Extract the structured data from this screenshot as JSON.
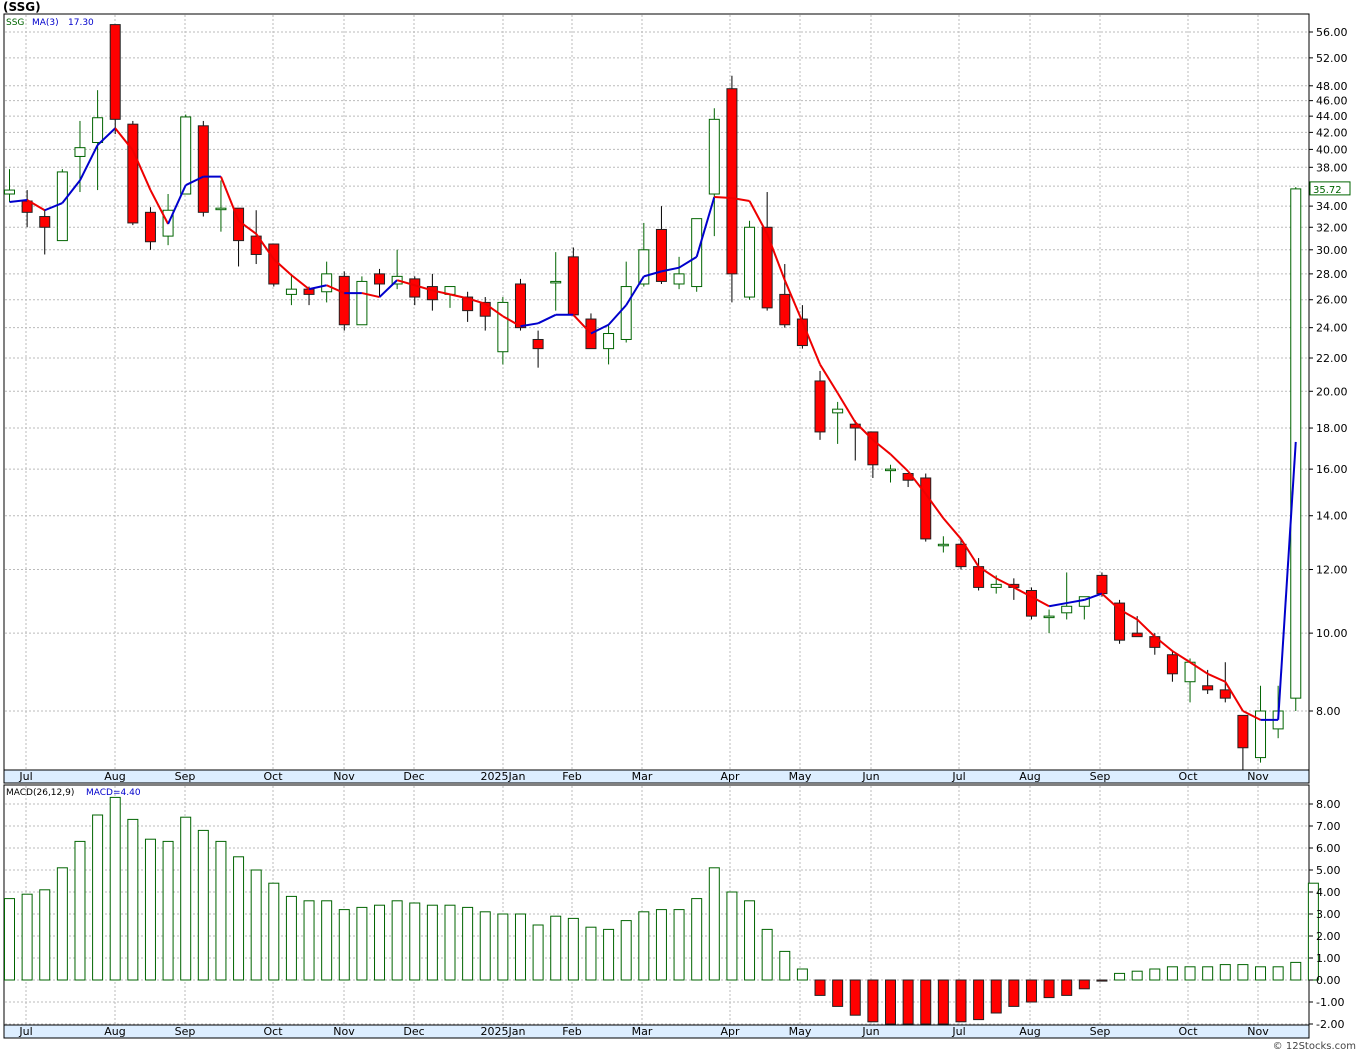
{
  "title": "(SSG)",
  "attribution": "© 12Stocks.com",
  "price_panel": {
    "legend": {
      "symbol": "SSG",
      "ma_label": "MA(3)",
      "ma_value": "17.30"
    },
    "last_price": "35.72",
    "scale": "log"
  },
  "macd_panel": {
    "legend": {
      "label": "MACD(26,12,9)",
      "value_label": "MACD=4.40"
    }
  },
  "x_labels": [
    "Jul",
    "Aug",
    "Sep",
    "Oct",
    "Nov",
    "Dec",
    "2025Jan",
    "Feb",
    "Mar",
    "Apr",
    "May",
    "Jun",
    "Jul",
    "Aug",
    "Sep",
    "Oct",
    "Nov"
  ],
  "price_ticks": [
    "56.00",
    "52.00",
    "48.00",
    "46.00",
    "44.00",
    "42.00",
    "40.00",
    "38.00",
    "36.00",
    "34.00",
    "32.00",
    "30.00",
    "28.00",
    "26.00",
    "24.00",
    "22.00",
    "20.00",
    "18.00",
    "16.00",
    "14.00",
    "12.00",
    "10.00",
    "8.00"
  ],
  "macd_ticks": [
    "8.00",
    "7.00",
    "6.00",
    "5.00",
    "4.00",
    "3.00",
    "2.00",
    "1.00",
    "0.00",
    "-1.00",
    "-2.00"
  ],
  "colors": {
    "up": "#ffffff",
    "down": "#ff0000",
    "up_border": "#006400",
    "ma_up": "#0000cc",
    "ma_down": "#ee0000",
    "macd_pos": "#006400",
    "macd_neg": "#ff0000",
    "axis_band": "#ddeeff"
  },
  "chart_data": [
    {
      "type": "candlestick",
      "title": "(SSG)",
      "scale": "log",
      "ylim": [
        6.6,
        60
      ],
      "x_month_labels": [
        "Jul",
        "Aug",
        "Sep",
        "Oct",
        "Nov",
        "Dec",
        "2025Jan",
        "Feb",
        "Mar",
        "Apr",
        "May",
        "Jun",
        "Jul",
        "Aug",
        "Sep",
        "Oct",
        "Nov"
      ],
      "candles": [
        {
          "o": 35.2,
          "h": 37.8,
          "l": 34.4,
          "c": 35.6
        },
        {
          "o": 34.5,
          "h": 35.6,
          "l": 32.0,
          "c": 33.4
        },
        {
          "o": 33.0,
          "h": 33.6,
          "l": 29.6,
          "c": 32.0
        },
        {
          "o": 30.8,
          "h": 37.8,
          "l": 30.8,
          "c": 37.5
        },
        {
          "o": 39.2,
          "h": 43.4,
          "l": 35.4,
          "c": 40.2
        },
        {
          "o": 40.8,
          "h": 47.4,
          "l": 35.6,
          "c": 43.8
        },
        {
          "o": 57.2,
          "h": 57.2,
          "l": 41.8,
          "c": 43.6
        },
        {
          "o": 43.0,
          "h": 43.4,
          "l": 32.2,
          "c": 32.4
        },
        {
          "o": 33.4,
          "h": 33.9,
          "l": 30.0,
          "c": 30.7
        },
        {
          "o": 31.2,
          "h": 35.2,
          "l": 30.4,
          "c": 33.6
        },
        {
          "o": 35.2,
          "h": 44.2,
          "l": 35.2,
          "c": 43.9
        },
        {
          "o": 42.8,
          "h": 43.4,
          "l": 33.0,
          "c": 33.4
        },
        {
          "o": 33.8,
          "h": 36.6,
          "l": 31.6,
          "c": 33.8
        },
        {
          "o": 33.8,
          "h": 33.8,
          "l": 28.6,
          "c": 30.8
        },
        {
          "o": 31.2,
          "h": 33.6,
          "l": 28.8,
          "c": 29.6
        },
        {
          "o": 30.5,
          "h": 30.5,
          "l": 27.0,
          "c": 27.2
        },
        {
          "o": 26.4,
          "h": 28.0,
          "l": 25.6,
          "c": 26.8
        },
        {
          "o": 26.8,
          "h": 27.0,
          "l": 25.6,
          "c": 26.4
        },
        {
          "o": 26.6,
          "h": 29.0,
          "l": 25.8,
          "c": 28.0
        },
        {
          "o": 27.8,
          "h": 28.2,
          "l": 23.8,
          "c": 24.2
        },
        {
          "o": 24.2,
          "h": 27.8,
          "l": 24.2,
          "c": 27.4
        },
        {
          "o": 28.0,
          "h": 28.4,
          "l": 26.2,
          "c": 27.2
        },
        {
          "o": 27.2,
          "h": 30.0,
          "l": 26.8,
          "c": 27.8
        },
        {
          "o": 27.6,
          "h": 27.8,
          "l": 25.6,
          "c": 26.2
        },
        {
          "o": 27.0,
          "h": 28.0,
          "l": 25.2,
          "c": 26.0
        },
        {
          "o": 26.4,
          "h": 27.0,
          "l": 25.4,
          "c": 27.0
        },
        {
          "o": 26.2,
          "h": 26.6,
          "l": 24.4,
          "c": 25.2
        },
        {
          "o": 25.8,
          "h": 26.2,
          "l": 23.8,
          "c": 24.8
        },
        {
          "o": 22.4,
          "h": 26.2,
          "l": 21.6,
          "c": 25.8
        },
        {
          "o": 27.2,
          "h": 27.6,
          "l": 23.8,
          "c": 24.0
        },
        {
          "o": 23.2,
          "h": 23.8,
          "l": 21.4,
          "c": 22.6
        },
        {
          "o": 27.4,
          "h": 29.8,
          "l": 25.2,
          "c": 27.4
        },
        {
          "o": 29.4,
          "h": 30.2,
          "l": 24.8,
          "c": 24.9
        },
        {
          "o": 24.6,
          "h": 25.0,
          "l": 22.6,
          "c": 22.6
        },
        {
          "o": 22.6,
          "h": 24.2,
          "l": 21.6,
          "c": 23.6
        },
        {
          "o": 23.2,
          "h": 29.0,
          "l": 23.0,
          "c": 27.0
        },
        {
          "o": 27.2,
          "h": 32.4,
          "l": 27.0,
          "c": 30.0
        },
        {
          "o": 31.8,
          "h": 34.0,
          "l": 27.2,
          "c": 27.4
        },
        {
          "o": 27.2,
          "h": 29.4,
          "l": 26.8,
          "c": 28.0
        },
        {
          "o": 27.0,
          "h": 32.8,
          "l": 26.6,
          "c": 32.8
        },
        {
          "o": 35.2,
          "h": 45.0,
          "l": 31.2,
          "c": 43.6
        },
        {
          "o": 47.6,
          "h": 49.4,
          "l": 25.8,
          "c": 28.0
        },
        {
          "o": 26.2,
          "h": 32.6,
          "l": 26.0,
          "c": 32.0
        },
        {
          "o": 32.0,
          "h": 35.4,
          "l": 25.2,
          "c": 25.4
        },
        {
          "o": 26.4,
          "h": 28.8,
          "l": 24.0,
          "c": 24.2
        },
        {
          "o": 24.6,
          "h": 25.6,
          "l": 22.6,
          "c": 22.8
        },
        {
          "o": 20.6,
          "h": 21.2,
          "l": 17.4,
          "c": 17.8
        },
        {
          "o": 18.8,
          "h": 19.4,
          "l": 17.2,
          "c": 19.0
        },
        {
          "o": 18.2,
          "h": 18.4,
          "l": 16.4,
          "c": 18.0
        },
        {
          "o": 17.8,
          "h": 17.8,
          "l": 15.6,
          "c": 16.2
        },
        {
          "o": 16.0,
          "h": 16.2,
          "l": 15.4,
          "c": 16.0
        },
        {
          "o": 15.8,
          "h": 15.8,
          "l": 15.2,
          "c": 15.5
        },
        {
          "o": 15.6,
          "h": 15.8,
          "l": 13.0,
          "c": 13.1
        },
        {
          "o": 12.9,
          "h": 13.2,
          "l": 12.6,
          "c": 12.9
        },
        {
          "o": 12.9,
          "h": 13.1,
          "l": 12.0,
          "c": 12.1
        },
        {
          "o": 12.1,
          "h": 12.4,
          "l": 11.3,
          "c": 11.4
        },
        {
          "o": 11.4,
          "h": 11.8,
          "l": 11.2,
          "c": 11.5
        },
        {
          "o": 11.5,
          "h": 11.7,
          "l": 11.0,
          "c": 11.4
        },
        {
          "o": 11.3,
          "h": 11.4,
          "l": 10.4,
          "c": 10.5
        },
        {
          "o": 10.5,
          "h": 10.7,
          "l": 10.0,
          "c": 10.5
        },
        {
          "o": 10.6,
          "h": 11.9,
          "l": 10.4,
          "c": 10.8
        },
        {
          "o": 10.8,
          "h": 11.1,
          "l": 10.4,
          "c": 11.1
        },
        {
          "o": 11.8,
          "h": 11.9,
          "l": 11.1,
          "c": 11.2
        },
        {
          "o": 10.9,
          "h": 11.0,
          "l": 9.7,
          "c": 9.8
        },
        {
          "o": 10.0,
          "h": 10.5,
          "l": 9.9,
          "c": 9.9
        },
        {
          "o": 9.9,
          "h": 10.0,
          "l": 9.4,
          "c": 9.6
        },
        {
          "o": 9.4,
          "h": 9.5,
          "l": 8.7,
          "c": 8.9
        },
        {
          "o": 8.7,
          "h": 9.3,
          "l": 8.2,
          "c": 9.2
        },
        {
          "o": 8.6,
          "h": 9.0,
          "l": 8.4,
          "c": 8.5
        },
        {
          "o": 8.5,
          "h": 9.2,
          "l": 8.2,
          "c": 8.3
        },
        {
          "o": 7.9,
          "h": 7.9,
          "l": 6.65,
          "c": 7.2
        },
        {
          "o": 7.0,
          "h": 8.6,
          "l": 6.9,
          "c": 8.0
        },
        {
          "o": 7.6,
          "h": 8.6,
          "l": 7.4,
          "c": 8.0
        },
        {
          "o": 8.3,
          "h": 35.9,
          "l": 8.0,
          "c": 35.72
        }
      ],
      "ma": {
        "name": "MA(3)",
        "values": [
          34.4,
          34.6,
          33.6,
          34.3,
          36.6,
          40.5,
          42.5,
          39.9,
          35.6,
          32.3,
          36.1,
          37.0,
          37.0,
          32.6,
          31.4,
          29.2,
          27.9,
          26.8,
          27.1,
          26.5,
          26.5,
          26.2,
          27.5,
          27.1,
          26.7,
          26.4,
          26.1,
          25.7,
          24.8,
          24.1,
          24.3,
          24.9,
          24.9,
          23.6,
          24.2,
          25.6,
          27.8,
          28.2,
          28.5,
          29.4,
          34.9,
          34.8,
          34.5,
          31.4,
          27.5,
          24.4,
          21.6,
          19.9,
          18.3,
          17.4,
          16.7,
          15.9,
          14.9,
          13.9,
          13.1,
          12.1,
          11.7,
          11.4,
          11.1,
          10.8,
          10.9,
          11.0,
          11.2,
          10.7,
          10.4,
          9.9,
          9.5,
          9.2,
          8.9,
          8.7,
          8.0,
          7.8,
          7.8,
          17.3
        ]
      }
    },
    {
      "type": "bar",
      "title": "MACD(26,12,9)",
      "ylim": [
        -2.2,
        8.5
      ],
      "values": [
        3.7,
        3.9,
        4.1,
        5.1,
        6.3,
        7.5,
        8.3,
        7.3,
        6.4,
        6.3,
        7.4,
        6.8,
        6.3,
        5.6,
        5.0,
        4.4,
        3.8,
        3.6,
        3.6,
        3.2,
        3.3,
        3.4,
        3.6,
        3.5,
        3.4,
        3.4,
        3.3,
        3.1,
        3.0,
        3.0,
        2.5,
        2.9,
        2.8,
        2.4,
        2.3,
        2.7,
        3.1,
        3.2,
        3.2,
        3.7,
        5.1,
        4.0,
        3.6,
        2.3,
        1.3,
        0.5,
        -0.7,
        -1.2,
        -1.6,
        -1.9,
        -2.0,
        -2.0,
        -2.0,
        -2.0,
        -1.9,
        -1.8,
        -1.5,
        -1.2,
        -1.0,
        -0.8,
        -0.7,
        -0.4,
        -0.05,
        0.3,
        0.4,
        0.5,
        0.6,
        0.6,
        0.6,
        0.7,
        0.7,
        0.6,
        0.6,
        0.8,
        4.4
      ]
    }
  ]
}
